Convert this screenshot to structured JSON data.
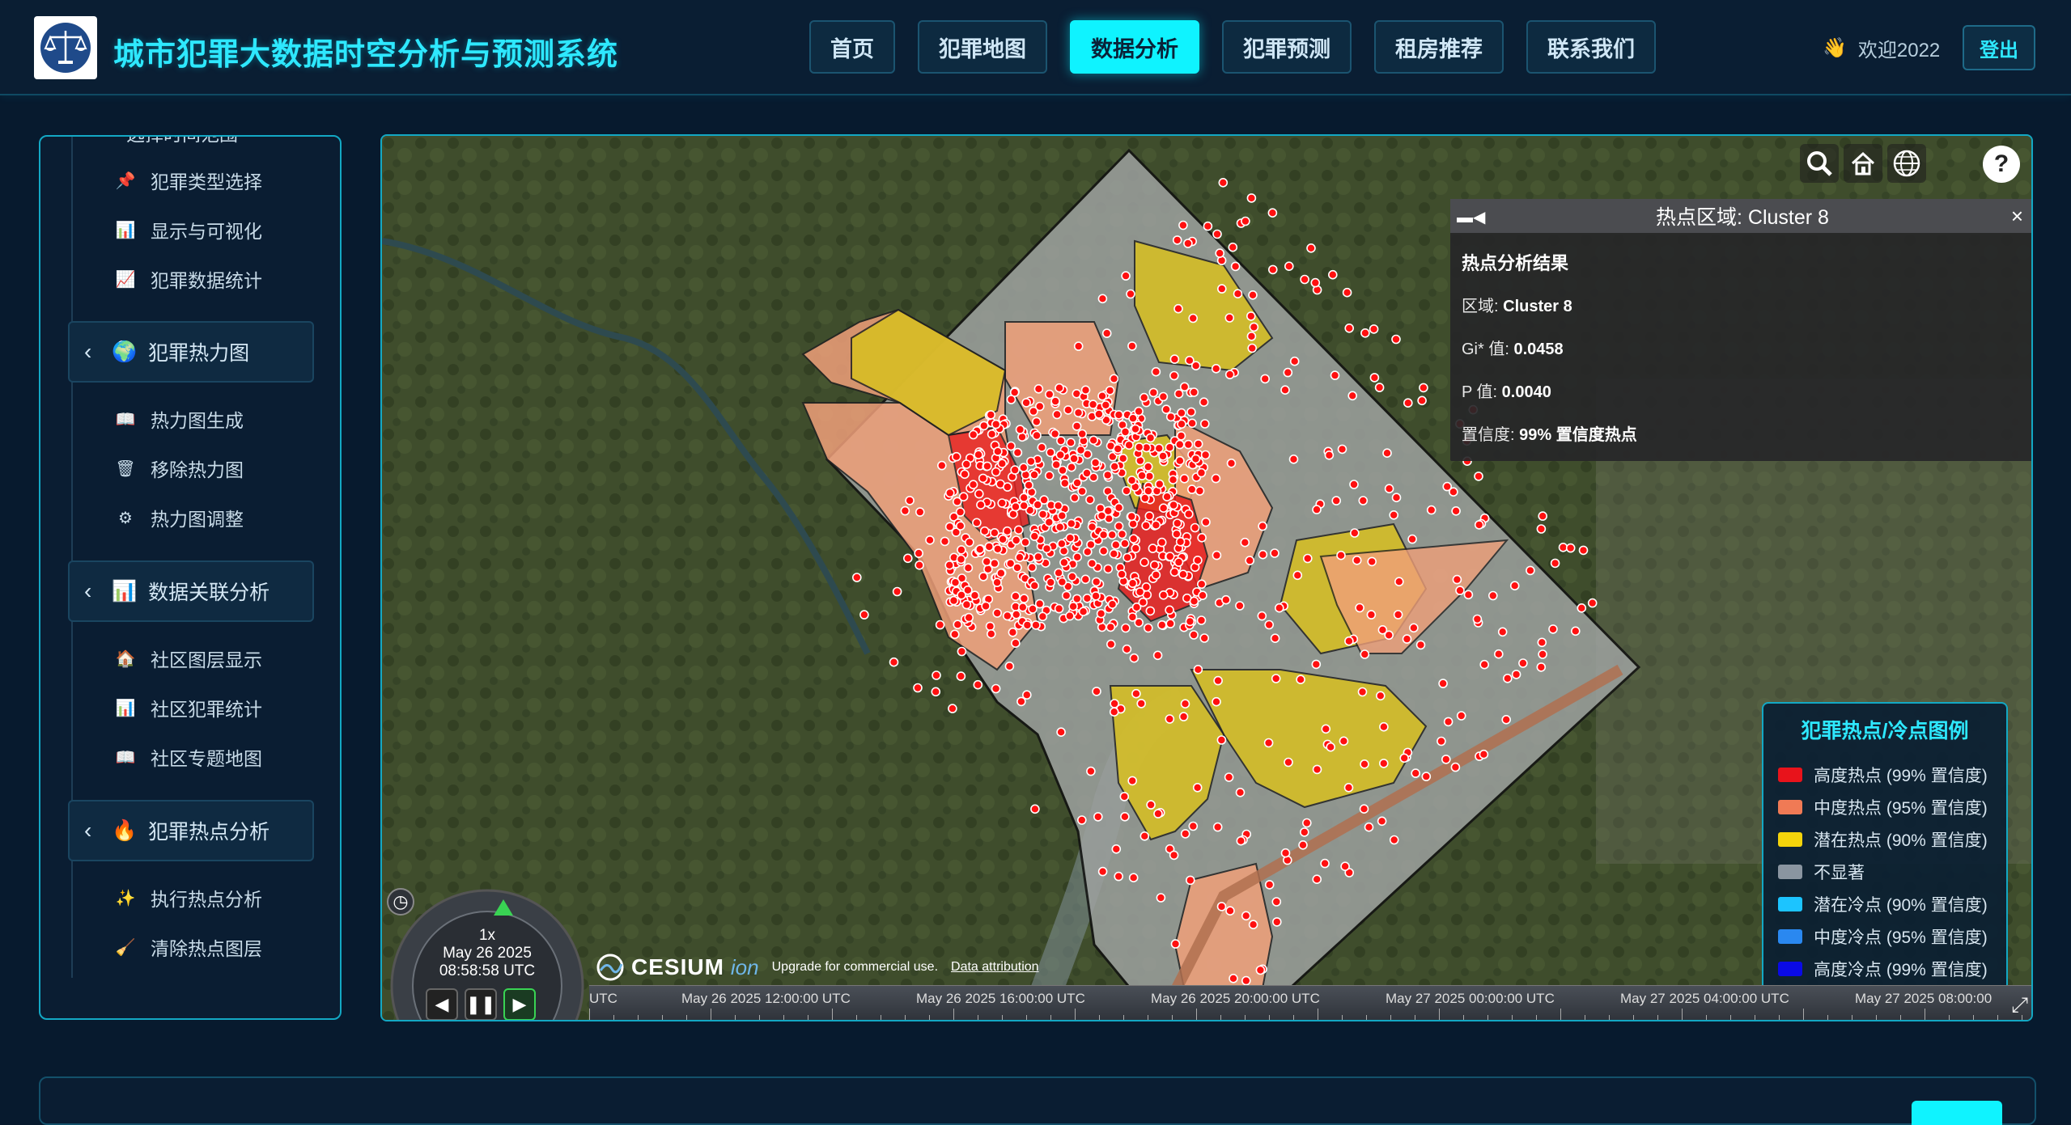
{
  "app": {
    "title": "城市犯罪大数据时空分析与预测系统",
    "nav": [
      "首页",
      "犯罪地图",
      "数据分析",
      "犯罪预测",
      "租房推荐",
      "联系我们"
    ],
    "active_nav": "数据分析",
    "welcome_icon": "👋",
    "welcome": "欢迎2022",
    "logout": "登出"
  },
  "sidebar": {
    "items_top": [
      {
        "icon": "📌",
        "label": "犯罪类型选择",
        "icon_name": "pin-icon"
      },
      {
        "icon": "📊",
        "label": "显示与可视化",
        "icon_name": "bar-chart-icon"
      },
      {
        "icon": "📈",
        "label": "犯罪数据统计",
        "icon_name": "line-chart-icon"
      }
    ],
    "groups": [
      {
        "icon": "🌍",
        "label": "犯罪热力图",
        "items": [
          {
            "icon": "📖",
            "label": "热力图生成"
          },
          {
            "icon": "🗑",
            "label": "移除热力图"
          },
          {
            "icon": "⚙",
            "label": "热力图调整"
          }
        ]
      },
      {
        "icon": "📊",
        "label": "数据关联分析",
        "items": [
          {
            "icon": "🏠",
            "label": "社区图层显示"
          },
          {
            "icon": "📊",
            "label": "社区犯罪统计"
          },
          {
            "icon": "📖",
            "label": "社区专题地图"
          }
        ]
      },
      {
        "icon": "🔥",
        "label": "犯罪热点分析",
        "items": [
          {
            "icon": "✨",
            "label": "执行热点分析"
          },
          {
            "icon": "🧹",
            "label": "清除热点图层"
          }
        ]
      }
    ]
  },
  "popup": {
    "title": "热点区域: Cluster 8",
    "heading": "热点分析结果",
    "region_label": "区域: ",
    "region_value": "Cluster 8",
    "gi_label": "Gi* 值: ",
    "gi_value": "0.0458",
    "p_label": "P 值: ",
    "p_value": "0.0040",
    "conf_label": "置信度: ",
    "conf_value": "99% 置信度热点",
    "close": "×"
  },
  "legend": {
    "title": "犯罪热点/冷点图例",
    "items": [
      {
        "label": "高度热点 (99% 置信度)",
        "color": "#e8131b"
      },
      {
        "label": "中度热点 (95% 置信度)",
        "color": "#f07a55"
      },
      {
        "label": "潜在热点 (90% 置信度)",
        "color": "#f4d40b"
      },
      {
        "label": "不显著",
        "color": "#8a95a0"
      },
      {
        "label": "潜在冷点 (90% 置信度)",
        "color": "#1cc4ff"
      },
      {
        "label": "中度冷点 (95% 置信度)",
        "color": "#2a88f0"
      },
      {
        "label": "高度冷点 (99% 置信度)",
        "color": "#0a0ae6"
      }
    ]
  },
  "cesium": {
    "brand": "CESIUM",
    "ion": "ion",
    "upgrade": "Upgrade for commercial use.",
    "attribution": "Data attribution"
  },
  "animation": {
    "speed": "1x",
    "date": "May 26 2025",
    "time": "08:58:58 UTC"
  },
  "timeline": {
    "labels": [
      "UTC",
      "May 26 2025 12:00:00 UTC",
      "May 26 2025 16:00:00 UTC",
      "May 26 2025 20:00:00 UTC",
      "May 27 2025 00:00:00 UTC",
      "May 27 2025 04:00:00 UTC",
      "May 27 2025 08:00:00"
    ]
  }
}
